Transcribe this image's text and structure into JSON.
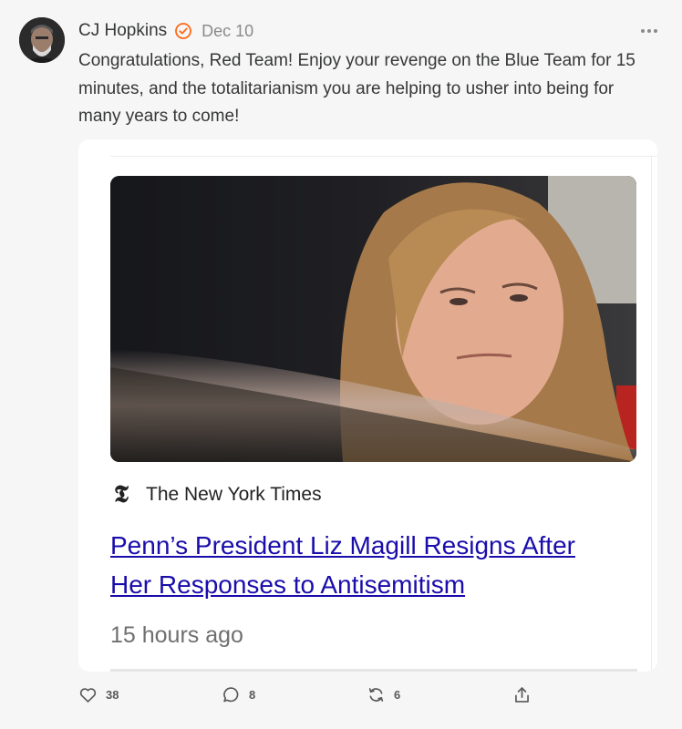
{
  "post": {
    "author": "CJ Hopkins",
    "date": "Dec 10",
    "text": "Congratulations, Red Team! Enjoy your revenge on the Blue Team for 15 minutes, and the totalitarianism you are helping to usher into being for many years to come!",
    "verified_color": "#ff6719"
  },
  "embed": {
    "source": "The New York Times",
    "source_logo": "𝕿",
    "headline": "Penn’s President Liz Magill Resigns After Her Responses to Antisemitism",
    "time_ago": "15 hours ago"
  },
  "actions": {
    "likes": "38",
    "comments": "8",
    "restacks": "6"
  },
  "icons": {
    "like": "heart-icon",
    "comment": "comment-bubble-icon",
    "restack": "restack-icon",
    "share": "share-icon",
    "more": "more-dots-icon",
    "verified": "verified-check-icon"
  }
}
